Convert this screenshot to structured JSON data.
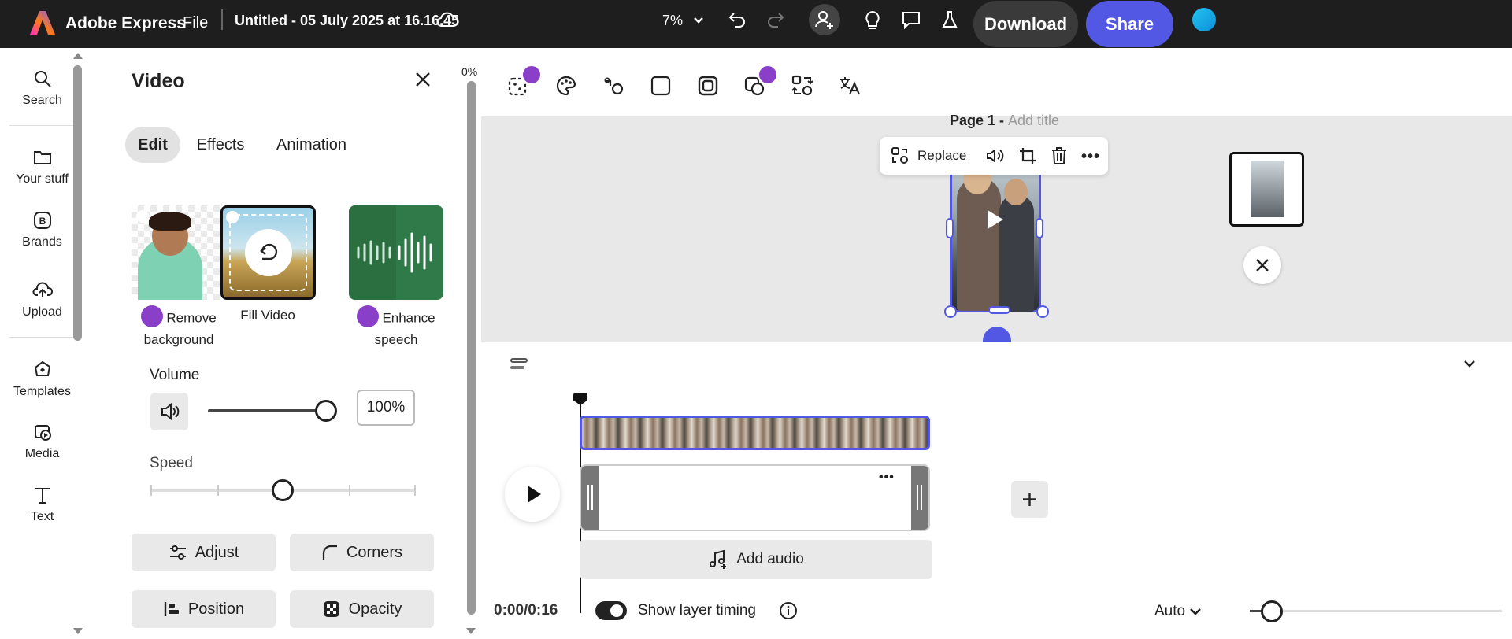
{
  "app": {
    "name": "Adobe Express",
    "file_menu": "File",
    "doc_title": "Untitled - 05 July 2025 at 16.16.45"
  },
  "topbar": {
    "zoom": "7%",
    "download_label": "Download",
    "share_label": "Share"
  },
  "rail": {
    "items": [
      {
        "label": "Search",
        "icon": "search-icon"
      },
      {
        "label": "Your stuff",
        "icon": "folder-icon"
      },
      {
        "label": "Brands",
        "icon": "brand-icon"
      },
      {
        "label": "Upload",
        "icon": "upload-icon"
      },
      {
        "label": "Templates",
        "icon": "templates-icon"
      },
      {
        "label": "Media",
        "icon": "media-icon"
      },
      {
        "label": "Text",
        "icon": "text-icon"
      }
    ]
  },
  "panel": {
    "title": "Video",
    "scroll_percent": "0%",
    "tabs": [
      {
        "label": "Edit"
      },
      {
        "label": "Effects"
      },
      {
        "label": "Animation"
      }
    ],
    "features": [
      {
        "label_line1": "Remove",
        "label_line2": "background",
        "premium": true
      },
      {
        "label_line1": "Fill Video",
        "label_line2": "",
        "premium": false
      },
      {
        "label_line1": "Enhance",
        "label_line2": "speech",
        "premium": true
      }
    ],
    "volume": {
      "label": "Volume",
      "value": "100%",
      "level": 1.0
    },
    "speed": {
      "label": "Speed",
      "level": 0.5
    },
    "buttons": {
      "adjust": "Adjust",
      "corners": "Corners",
      "position": "Position",
      "opacity": "Opacity"
    }
  },
  "canvas": {
    "page_label": "Page 1 - ",
    "page_title_placeholder": "Add title",
    "context_toolbar": {
      "replace_label": "Replace"
    }
  },
  "timeline": {
    "time": "0:00/0:16",
    "show_layer_timing": "Show layer timing",
    "show_layer_timing_on": true,
    "add_audio": "Add audio",
    "zoom_mode": "Auto"
  },
  "colors": {
    "accent": "#5258e4",
    "topbar": "#1e1e1e",
    "premium": "#8a3fc9"
  }
}
